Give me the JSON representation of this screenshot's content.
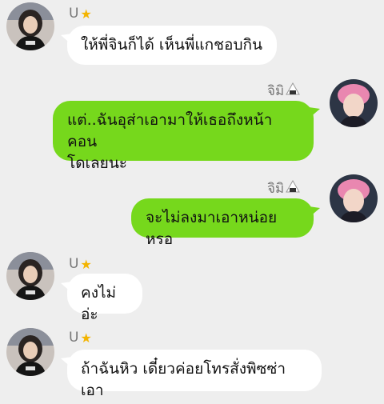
{
  "colors": {
    "background": "#eeeeee",
    "incoming_bubble": "#ffffff",
    "outgoing_bubble": "#76d81c",
    "name_text": "#777777",
    "star": "#f3b400"
  },
  "messages": [
    {
      "sender": "U",
      "sender_badge": "star-icon",
      "side": "left",
      "text": "ให้พี่จินก็ได้ เห็นพี่แกชอบกิน"
    },
    {
      "sender": "จิมิ",
      "sender_badge": "rice-ball-icon",
      "side": "right",
      "text_line1": "แต่..ฉันอุส่าเอามาให้เธอถึงหน้าคอน",
      "text_line2": "โดเลยนะ"
    },
    {
      "sender": "จิมิ",
      "sender_badge": "rice-ball-icon",
      "side": "right",
      "text": "จะไม่ลงมาเอาหน่อยหรอ"
    },
    {
      "sender": "U",
      "sender_badge": "star-icon",
      "side": "left",
      "text": "คงไม่อ่ะ"
    },
    {
      "sender": "U",
      "sender_badge": "star-icon",
      "side": "left",
      "text": "ถ้าฉันหิว เดี๋ยวค่อยโทรสั่งพิซซ่าเอา"
    }
  ]
}
